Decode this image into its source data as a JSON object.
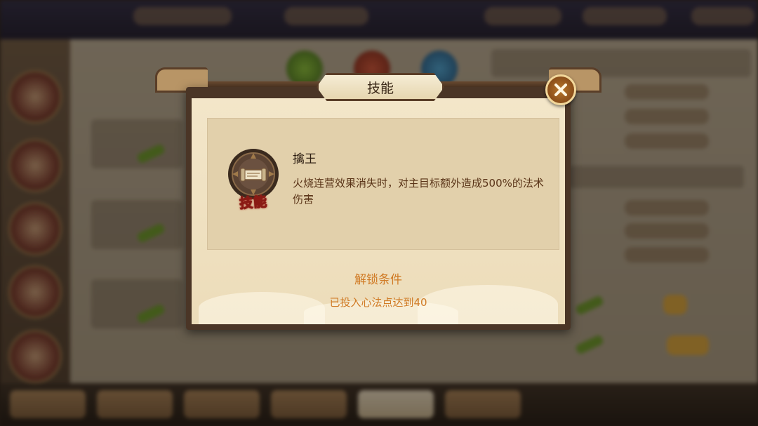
{
  "dialog": {
    "title": "技能",
    "close_icon": "close-x-icon",
    "skill": {
      "name": "擒王",
      "badge": "技能",
      "description": "火烧连营效果消失时，对主目标额外造成500%的法术伤害",
      "icon": "skill-scroll-icon"
    },
    "unlock": {
      "title": "解锁条件",
      "condition": "已投入心法点达到40"
    }
  },
  "colors": {
    "frame": "#4a3526",
    "parchment": "#f3e6c9",
    "accent_orange": "#d07a24",
    "badge_red": "#a3231a",
    "close_gold": "#b8762a"
  }
}
